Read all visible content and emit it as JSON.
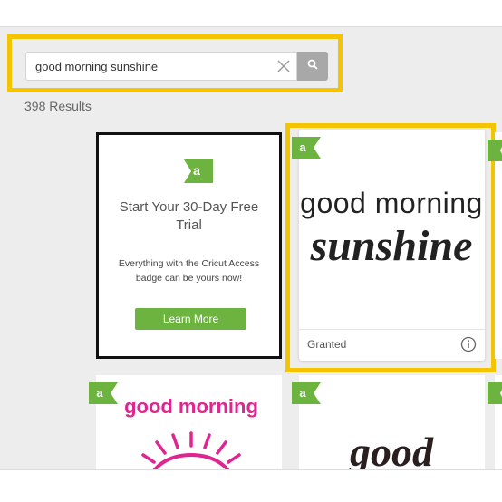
{
  "search": {
    "query": "good morning sunshine"
  },
  "results": {
    "count_text": "398 Results"
  },
  "promo": {
    "badge_letter": "a",
    "title": "Start Your 30-Day Free Trial",
    "description": "Everything with the Cricut Access badge can be yours now!",
    "button_label": "Learn More"
  },
  "design_card": {
    "badge_letter": "a",
    "art_line1": "good morning",
    "art_line2": "sunshine",
    "status": "Granted"
  },
  "row2": {
    "left_badge": "a",
    "left_art_text": "good morning",
    "mid_badge": "a",
    "mid_art_text": "good",
    "right_badge": "a"
  },
  "colors": {
    "highlight": "#f5c400",
    "access_green": "#6db33f",
    "search_button": "#a8a8a8",
    "art_pink": "#e02591"
  }
}
